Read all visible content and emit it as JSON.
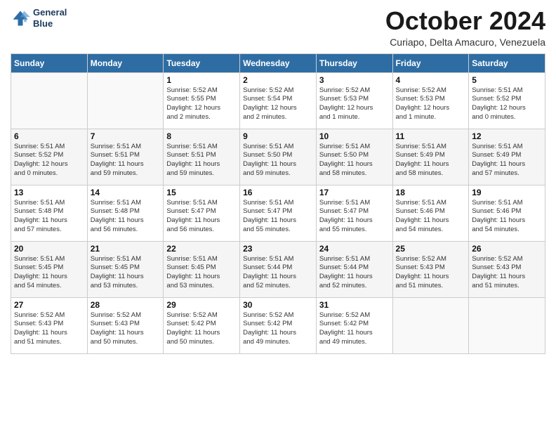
{
  "logo": {
    "line1": "General",
    "line2": "Blue"
  },
  "title": "October 2024",
  "subtitle": "Curiapo, Delta Amacuro, Venezuela",
  "weekdays": [
    "Sunday",
    "Monday",
    "Tuesday",
    "Wednesday",
    "Thursday",
    "Friday",
    "Saturday"
  ],
  "weeks": [
    [
      {
        "day": "",
        "info": ""
      },
      {
        "day": "",
        "info": ""
      },
      {
        "day": "1",
        "info": "Sunrise: 5:52 AM\nSunset: 5:55 PM\nDaylight: 12 hours\nand 2 minutes."
      },
      {
        "day": "2",
        "info": "Sunrise: 5:52 AM\nSunset: 5:54 PM\nDaylight: 12 hours\nand 2 minutes."
      },
      {
        "day": "3",
        "info": "Sunrise: 5:52 AM\nSunset: 5:53 PM\nDaylight: 12 hours\nand 1 minute."
      },
      {
        "day": "4",
        "info": "Sunrise: 5:52 AM\nSunset: 5:53 PM\nDaylight: 12 hours\nand 1 minute."
      },
      {
        "day": "5",
        "info": "Sunrise: 5:51 AM\nSunset: 5:52 PM\nDaylight: 12 hours\nand 0 minutes."
      }
    ],
    [
      {
        "day": "6",
        "info": "Sunrise: 5:51 AM\nSunset: 5:52 PM\nDaylight: 12 hours\nand 0 minutes."
      },
      {
        "day": "7",
        "info": "Sunrise: 5:51 AM\nSunset: 5:51 PM\nDaylight: 11 hours\nand 59 minutes."
      },
      {
        "day": "8",
        "info": "Sunrise: 5:51 AM\nSunset: 5:51 PM\nDaylight: 11 hours\nand 59 minutes."
      },
      {
        "day": "9",
        "info": "Sunrise: 5:51 AM\nSunset: 5:50 PM\nDaylight: 11 hours\nand 59 minutes."
      },
      {
        "day": "10",
        "info": "Sunrise: 5:51 AM\nSunset: 5:50 PM\nDaylight: 11 hours\nand 58 minutes."
      },
      {
        "day": "11",
        "info": "Sunrise: 5:51 AM\nSunset: 5:49 PM\nDaylight: 11 hours\nand 58 minutes."
      },
      {
        "day": "12",
        "info": "Sunrise: 5:51 AM\nSunset: 5:49 PM\nDaylight: 11 hours\nand 57 minutes."
      }
    ],
    [
      {
        "day": "13",
        "info": "Sunrise: 5:51 AM\nSunset: 5:48 PM\nDaylight: 11 hours\nand 57 minutes."
      },
      {
        "day": "14",
        "info": "Sunrise: 5:51 AM\nSunset: 5:48 PM\nDaylight: 11 hours\nand 56 minutes."
      },
      {
        "day": "15",
        "info": "Sunrise: 5:51 AM\nSunset: 5:47 PM\nDaylight: 11 hours\nand 56 minutes."
      },
      {
        "day": "16",
        "info": "Sunrise: 5:51 AM\nSunset: 5:47 PM\nDaylight: 11 hours\nand 55 minutes."
      },
      {
        "day": "17",
        "info": "Sunrise: 5:51 AM\nSunset: 5:47 PM\nDaylight: 11 hours\nand 55 minutes."
      },
      {
        "day": "18",
        "info": "Sunrise: 5:51 AM\nSunset: 5:46 PM\nDaylight: 11 hours\nand 54 minutes."
      },
      {
        "day": "19",
        "info": "Sunrise: 5:51 AM\nSunset: 5:46 PM\nDaylight: 11 hours\nand 54 minutes."
      }
    ],
    [
      {
        "day": "20",
        "info": "Sunrise: 5:51 AM\nSunset: 5:45 PM\nDaylight: 11 hours\nand 54 minutes."
      },
      {
        "day": "21",
        "info": "Sunrise: 5:51 AM\nSunset: 5:45 PM\nDaylight: 11 hours\nand 53 minutes."
      },
      {
        "day": "22",
        "info": "Sunrise: 5:51 AM\nSunset: 5:45 PM\nDaylight: 11 hours\nand 53 minutes."
      },
      {
        "day": "23",
        "info": "Sunrise: 5:51 AM\nSunset: 5:44 PM\nDaylight: 11 hours\nand 52 minutes."
      },
      {
        "day": "24",
        "info": "Sunrise: 5:51 AM\nSunset: 5:44 PM\nDaylight: 11 hours\nand 52 minutes."
      },
      {
        "day": "25",
        "info": "Sunrise: 5:52 AM\nSunset: 5:43 PM\nDaylight: 11 hours\nand 51 minutes."
      },
      {
        "day": "26",
        "info": "Sunrise: 5:52 AM\nSunset: 5:43 PM\nDaylight: 11 hours\nand 51 minutes."
      }
    ],
    [
      {
        "day": "27",
        "info": "Sunrise: 5:52 AM\nSunset: 5:43 PM\nDaylight: 11 hours\nand 51 minutes."
      },
      {
        "day": "28",
        "info": "Sunrise: 5:52 AM\nSunset: 5:43 PM\nDaylight: 11 hours\nand 50 minutes."
      },
      {
        "day": "29",
        "info": "Sunrise: 5:52 AM\nSunset: 5:42 PM\nDaylight: 11 hours\nand 50 minutes."
      },
      {
        "day": "30",
        "info": "Sunrise: 5:52 AM\nSunset: 5:42 PM\nDaylight: 11 hours\nand 49 minutes."
      },
      {
        "day": "31",
        "info": "Sunrise: 5:52 AM\nSunset: 5:42 PM\nDaylight: 11 hours\nand 49 minutes."
      },
      {
        "day": "",
        "info": ""
      },
      {
        "day": "",
        "info": ""
      }
    ]
  ]
}
